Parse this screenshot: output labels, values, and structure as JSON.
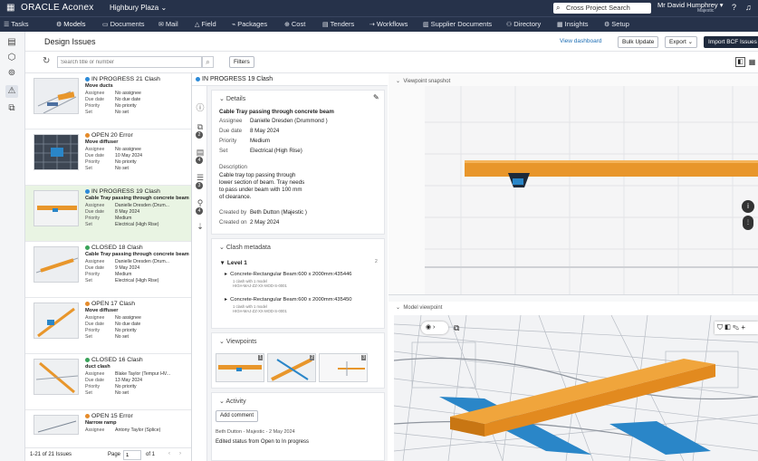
{
  "app": {
    "logo": "ORACLE Aconex",
    "project": "Highbury Plaza",
    "search_placeholder": "Cross Project Search",
    "user_name": "Mr David Humphrey",
    "org": "Majestic"
  },
  "nav": [
    "Tasks",
    "Models",
    "Documents",
    "Mail",
    "Field",
    "Packages",
    "Cost",
    "Tenders",
    "Workflows",
    "Supplier Documents",
    "Directory",
    "Insights",
    "Setup"
  ],
  "page": {
    "title": "Design Issues",
    "view_dashboard": "View dashboard",
    "bulk_update": "Bulk Update",
    "export": "Export",
    "import_bcf": "Import BCF Issues",
    "search_placeholder": "Search title or number",
    "filters": "Filters"
  },
  "issues": [
    {
      "status": "IN PROGRESS",
      "num": "21",
      "type": "Clash",
      "title": "Move ducts",
      "assignee": "No assignee",
      "due": "No due date",
      "priority": "No priority",
      "set": "No set",
      "color": "#2c8ad8"
    },
    {
      "status": "OPEN",
      "num": "20",
      "type": "Error",
      "title": "Move diffuser",
      "assignee": "No assignee",
      "due": "10 May 2024",
      "priority": "No priority",
      "set": "No set",
      "color": "#e58b2a"
    },
    {
      "status": "IN PROGRESS",
      "num": "19",
      "type": "Clash",
      "title": "Cable Tray passing through concrete beam",
      "assignee": "Danielle Dresden (Drum...",
      "due": "8 May 2024",
      "priority": "Medium",
      "set": "Electrical (High Rise)",
      "color": "#2c8ad8"
    },
    {
      "status": "CLOSED",
      "num": "18",
      "type": "Clash",
      "title": "Cable Tray passing through concrete beam",
      "assignee": "Danielle Dresden (Drum...",
      "due": "9 May 2024",
      "priority": "Medium",
      "set": "Electrical (High Rise)",
      "color": "#3aa35a"
    },
    {
      "status": "OPEN",
      "num": "17",
      "type": "Clash",
      "title": "Move diffuser",
      "assignee": "No assignee",
      "due": "No due date",
      "priority": "No priority",
      "set": "No set",
      "color": "#e58b2a"
    },
    {
      "status": "CLOSED",
      "num": "16",
      "type": "Clash",
      "title": "duct clash",
      "assignee": "Blake Taylor (Tempur HV...",
      "due": "13 May 2024",
      "priority": "No priority",
      "set": "No set",
      "color": "#3aa35a"
    },
    {
      "status": "OPEN",
      "num": "15",
      "type": "Error",
      "title": "Narrow ramp",
      "assignee": "Antony Taylor (Splice)",
      "due": "",
      "priority": "",
      "set": "",
      "color": "#e58b2a"
    }
  ],
  "labels": {
    "assignee": "Assignee",
    "due": "Due date",
    "priority": "Priority",
    "set": "Set"
  },
  "list_footer": {
    "count": "1-21 of 21 Issues",
    "page_label": "Page",
    "page": "1",
    "of": "of 1"
  },
  "detail": {
    "header": "IN PROGRESS 19 Clash",
    "details_title": "Details",
    "issue_title": "Cable Tray passing through concrete beam",
    "assignee_label": "Assignee",
    "assignee": "Danielle Dresden (Drummond )",
    "due_label": "Due date",
    "due": "8 May 2024",
    "priority_label": "Priority",
    "priority": "Medium",
    "set_label": "Set",
    "set": "Electrical (High Rise)",
    "desc_label": "Description",
    "desc": [
      "Cable tray top passing through",
      "lower section of beam. Tray needs",
      "to pass under beam with 100 mm",
      "of clearance."
    ],
    "created_by_label": "Created by",
    "created_by": "Beth Dutton (Majestic )",
    "created_on_label": "Created on",
    "created_on": "2 May 2024",
    "clash_title": "Clash metadata",
    "level": "Level 1",
    "level_count": "2",
    "clash1": "Concrete-Rectangular Beam:600 x 2000mm:435446",
    "clash2": "Concrete-Rectangular Beam:600 x 2000mm:435450",
    "clash_sub": "1 clash with 1 model",
    "clash_file": "HIGH-MAJ-ZZ-XX-MOD-S-0001",
    "viewpoints_title": "Viewpoints",
    "activity_title": "Activity",
    "add_comment": "Add comment",
    "activity_meta": "Beth Dutton - Majestic - 2 May 2024",
    "activity_text": "Edited status from Open to In progress",
    "badges": [
      "2",
      "4",
      "3",
      "4"
    ],
    "vp_nums": [
      "1",
      "2",
      "3"
    ]
  },
  "viewer": {
    "snapshot_label": "Viewpoint snapshot",
    "model_label": "Model viewpoint"
  },
  "colors": {
    "header": "#26324a",
    "orange": "#e8962b",
    "blue": "#2a86c8"
  }
}
